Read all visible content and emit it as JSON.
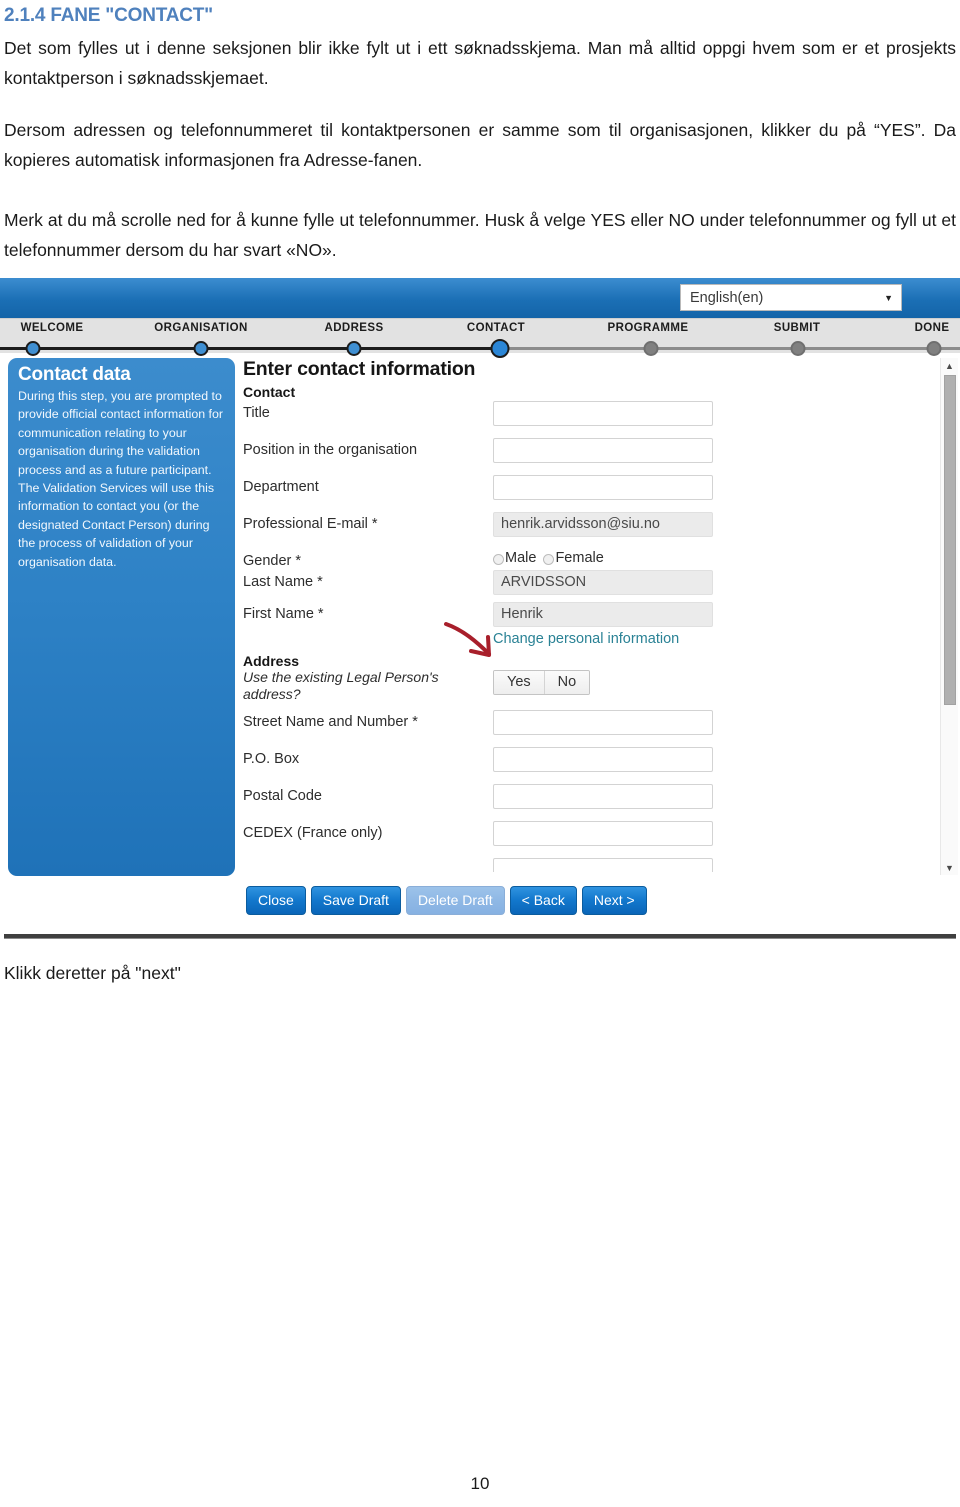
{
  "document": {
    "heading": "2.1.4 FANE \"CONTACT\"",
    "paragraph_1": "Det som fylles ut i denne seksjonen blir ikke fylt ut i ett søknadsskjema. Man må alltid oppgi hvem som er et prosjekts kontaktperson i søknadsskjemaet.",
    "paragraph_2": "Dersom adressen og telefonnummeret til kontaktpersonen er samme som til organisasjonen, klikker du på “YES”. Da kopieres automatisk informasjonen fra Adresse-fanen.",
    "paragraph_3": "Merk at du må scrolle ned for å kunne fylle ut telefonnummer. Husk å velge YES eller NO under telefonnummer og fyll ut et telefonnummer dersom du har svart «NO».",
    "footer_text": "Klikk deretter på \"next\"",
    "page_number": "10"
  },
  "screenshot": {
    "language_select": {
      "value": "English(en)",
      "caret": "▼"
    },
    "steps": [
      {
        "label": "WELCOME",
        "state": "done"
      },
      {
        "label": "ORGANISATION",
        "state": "done"
      },
      {
        "label": "ADDRESS",
        "state": "done"
      },
      {
        "label": "CONTACT",
        "state": "current"
      },
      {
        "label": "PROGRAMME",
        "state": "upcoming"
      },
      {
        "label": "SUBMIT",
        "state": "upcoming"
      },
      {
        "label": "DONE",
        "state": "upcoming"
      }
    ],
    "help_panel": {
      "title": "Contact data",
      "body": "During this step, you are prompted to provide official contact information for communication relating to your organisation during the validation process and as a future participant. The Validation Services will use this information to contact you (or the designated Contact Person) during the process of validation of your organisation data."
    },
    "form": {
      "title": "Enter contact information",
      "contact_section_label": "Contact",
      "address_section_label": "Address",
      "fields": {
        "title": {
          "label": "Title",
          "value": ""
        },
        "position": {
          "label": "Position in the organisation",
          "value": ""
        },
        "department": {
          "label": "Department",
          "value": ""
        },
        "email": {
          "label": "Professional E-mail *",
          "value": "henrik.arvidsson@siu.no"
        },
        "gender": {
          "label": "Gender *",
          "options": [
            "Male",
            "Female"
          ],
          "selected": ""
        },
        "last_name": {
          "label": "Last Name *",
          "value": "ARVIDSSON"
        },
        "first_name": {
          "label": "First Name *",
          "value": "Henrik"
        },
        "use_legal_address": {
          "label": "Use the existing Legal Person's address?",
          "options": [
            "Yes",
            "No"
          ],
          "selected": ""
        },
        "street": {
          "label": "Street Name and Number *",
          "value": ""
        },
        "po_box": {
          "label": "P.O. Box",
          "value": ""
        },
        "postal_code": {
          "label": "Postal Code",
          "value": ""
        },
        "cedex": {
          "label": "CEDEX (France only)",
          "value": ""
        }
      },
      "change_personal_link": "Change personal information"
    },
    "buttons": [
      {
        "label": "Close",
        "state": "enabled"
      },
      {
        "label": "Save Draft",
        "state": "enabled"
      },
      {
        "label": "Delete Draft",
        "state": "disabled"
      },
      {
        "label": "< Back",
        "state": "enabled"
      },
      {
        "label": "Next >",
        "state": "enabled"
      }
    ],
    "scrollbar": {
      "up": "▲",
      "down": "▼"
    },
    "colors": {
      "header_blue": "#1b6fb5",
      "help_panel_blue": "#2e82c6",
      "step_active": "#3f8fd2",
      "step_inactive": "#808080",
      "link_teal": "#2a8295",
      "annotation_red": "#a81f2b",
      "heading_blue": "#4f81bd"
    }
  }
}
